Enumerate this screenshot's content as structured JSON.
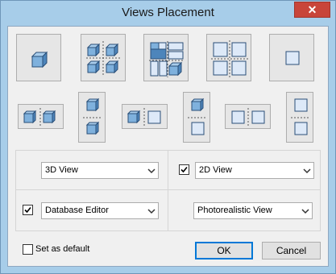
{
  "window": {
    "title": "Views Placement",
    "close_glyph": "✕"
  },
  "layout_options_row1": [
    {
      "id": "single-3d-view-tile",
      "icon": "cube-icon"
    },
    {
      "id": "four-3d-views-tile",
      "icon": "four-cubes-icon"
    },
    {
      "id": "mixed-views-tile",
      "icon": "mixed-views-icon"
    },
    {
      "id": "four-2d-views-tile",
      "icon": "four-squares-icon"
    },
    {
      "id": "single-2d-view-tile",
      "icon": "square-icon"
    }
  ],
  "layout_options_row2": [
    {
      "id": "two-3d-side-by-side-tile",
      "icon": "two-cubes-horizontal-icon"
    },
    {
      "id": "two-3d-stacked-tile",
      "icon": "two-cubes-vertical-icon"
    },
    {
      "id": "3d-and-2d-side-by-side-tile",
      "icon": "cube-square-horizontal-icon"
    },
    {
      "id": "3d-over-2d-stacked-tile",
      "icon": "cube-square-vertical-icon"
    },
    {
      "id": "two-2d-side-by-side-tile",
      "icon": "two-squares-horizontal-icon"
    },
    {
      "id": "two-2d-stacked-tile",
      "icon": "two-squares-vertical-icon"
    }
  ],
  "panels": {
    "top_left": {
      "view": "3D View",
      "has_checkbox": false
    },
    "top_right": {
      "view": "2D View",
      "checked": true
    },
    "bottom_left": {
      "view": "Database Editor",
      "checked": true
    },
    "bottom_right": {
      "view": "Photorealistic View",
      "has_checkbox": false
    }
  },
  "set_default": {
    "label": "Set as default",
    "checked": false
  },
  "buttons": {
    "ok": "OK",
    "cancel": "Cancel"
  },
  "colors": {
    "cube_face": "#7fb1dd",
    "cube_top": "#a9cdec",
    "cube_side": "#4d85bb",
    "square_fill": "#dde9f8",
    "icon_outline": "#2a4f78"
  }
}
